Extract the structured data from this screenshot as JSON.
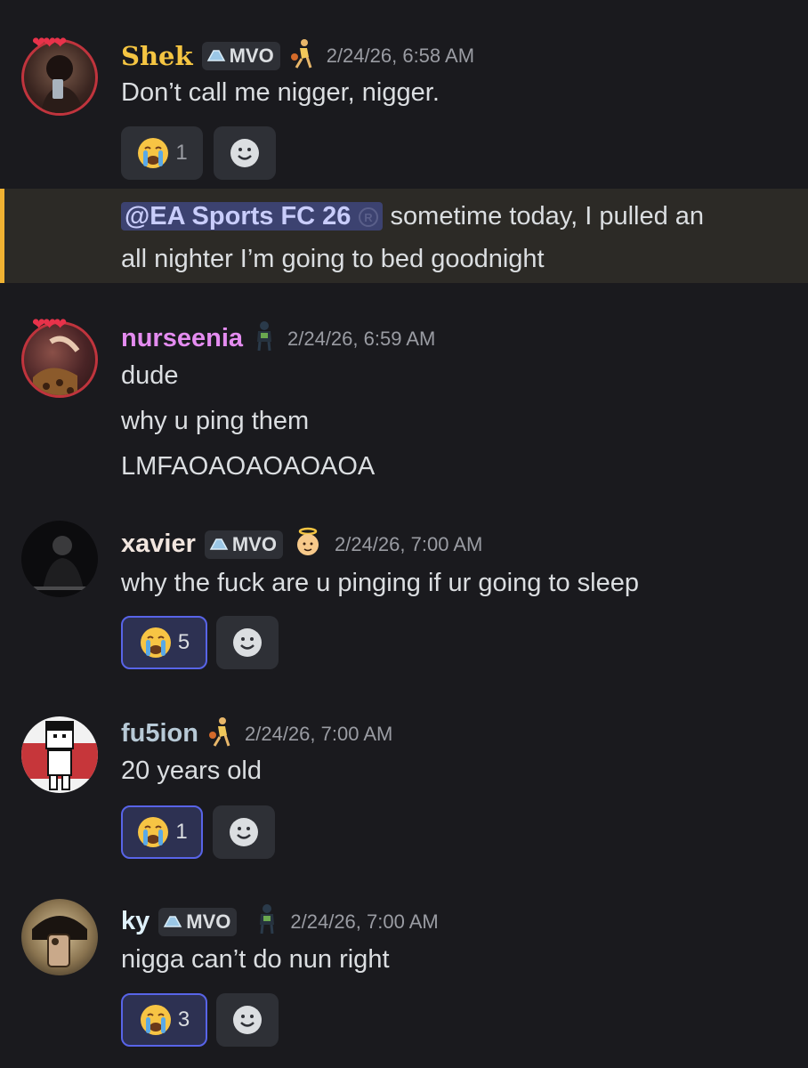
{
  "messages": [
    {
      "username": "Shek",
      "username_color": "#f5c542",
      "badge": "MVO",
      "role_icon": "basketball-player-icon",
      "timestamp": "2/24/26, 6:58 AM",
      "lines": [
        "Don’t call me nigger, nigger."
      ],
      "reaction": {
        "emoji": "sob-emoji",
        "count": "1",
        "active": false
      }
    },
    {
      "mention": "@EA Sports FC 26",
      "mention_icon": "registered-icon",
      "lines": [
        "sometime today, I pulled an",
        "all nighter I’m going to bed goodnight"
      ]
    },
    {
      "username": "nurseenia",
      "username_color": "#e48cf0",
      "role_icon": "football-player-icon",
      "timestamp": "2/24/26, 6:59 AM",
      "lines": [
        "dude",
        "why u ping them",
        "LMFAOAOAOAOAOA"
      ]
    },
    {
      "username": "xavier",
      "username_color": "#f2e6df",
      "badge": "MVO",
      "role_icon": "angel-baby-icon",
      "timestamp": "2/24/26, 7:00 AM",
      "lines": [
        "why the fuck are u pinging if ur going to sleep"
      ],
      "reaction": {
        "emoji": "sob-emoji",
        "count": "5",
        "active": true
      }
    },
    {
      "username": "fu5ion",
      "username_color": "#b7c9d6",
      "role_icon": "basketball-player-icon",
      "timestamp": "2/24/26, 7:00 AM",
      "lines": [
        "20 years old"
      ],
      "reaction": {
        "emoji": "sob-emoji",
        "count": "1",
        "active": true
      }
    },
    {
      "username": "ky",
      "username_color": "#dff1fb",
      "badge": "MVO",
      "role_icon": "football-player-icon",
      "timestamp": "2/24/26, 7:00 AM",
      "lines": [
        "nigga can’t do nun right"
      ],
      "reaction": {
        "emoji": "sob-emoji",
        "count": "3",
        "active": true
      }
    }
  ]
}
